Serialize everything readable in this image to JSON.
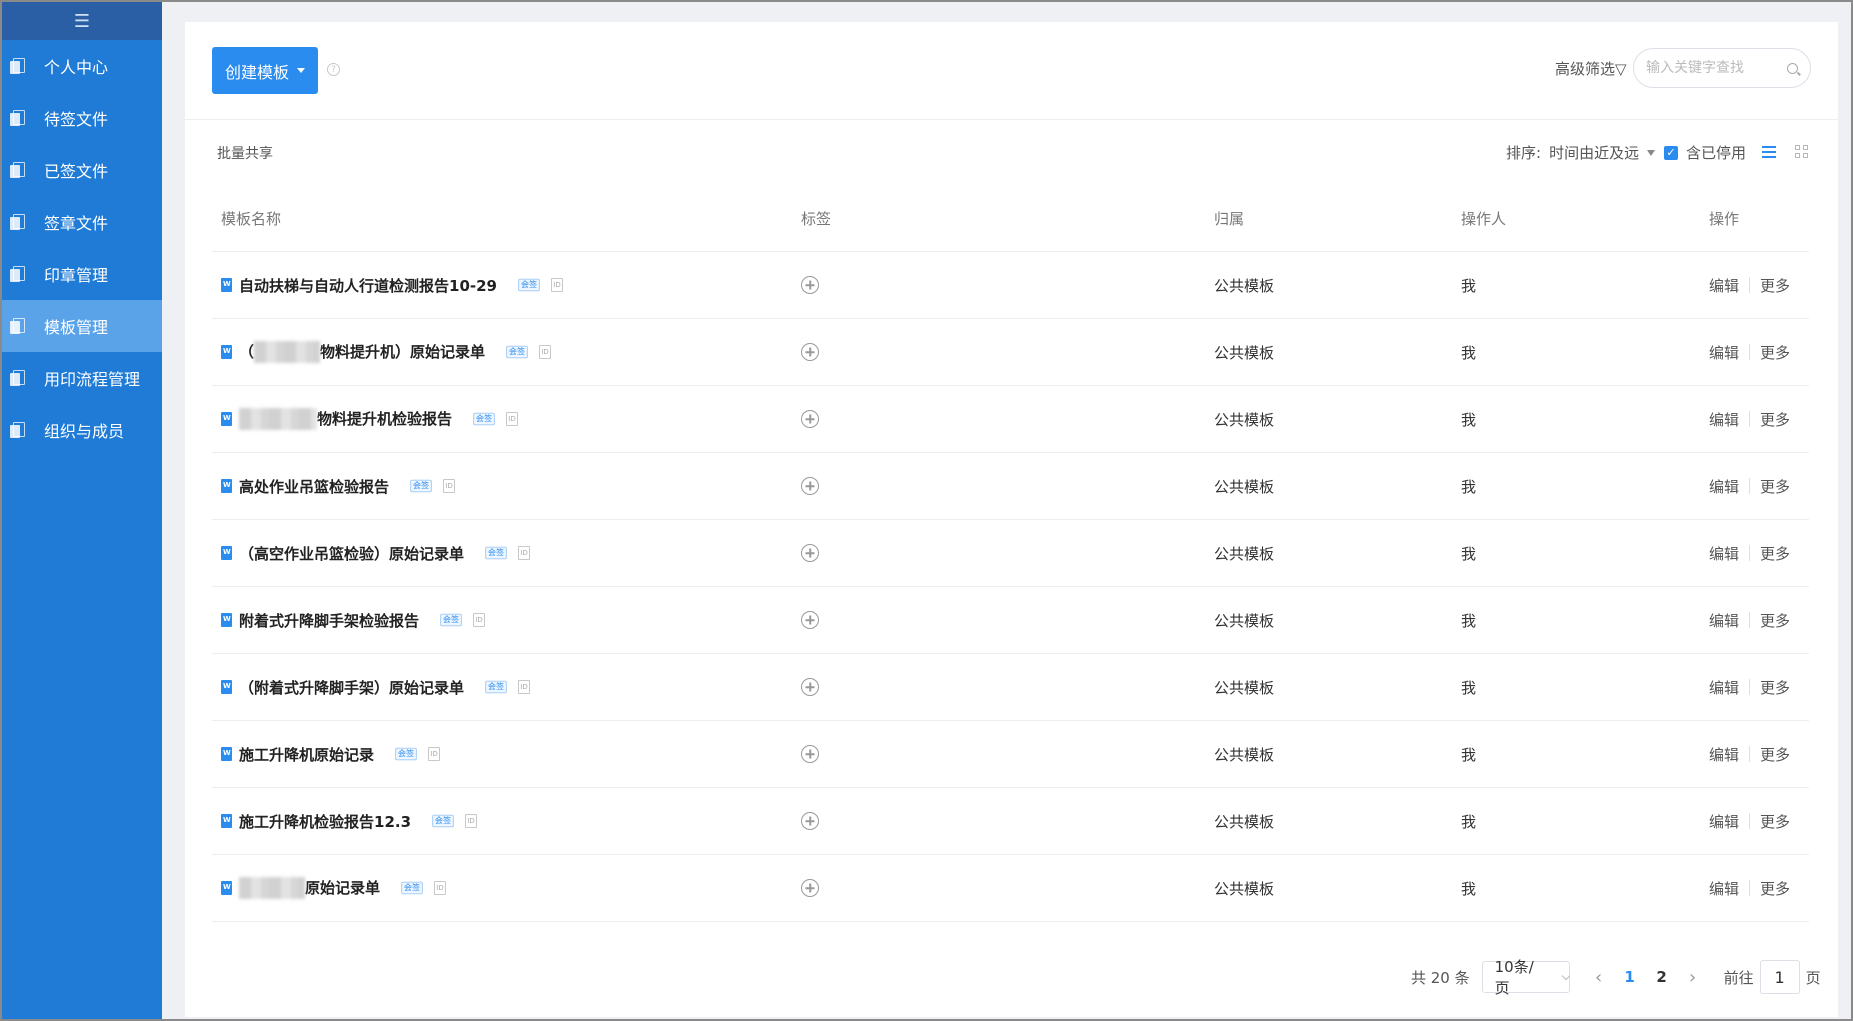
{
  "sidebar": {
    "toggle_icon": "☰",
    "items": [
      {
        "label": "个人中心",
        "active": false
      },
      {
        "label": "待签文件",
        "active": false
      },
      {
        "label": "已签文件",
        "active": false
      },
      {
        "label": "签章文件",
        "active": false
      },
      {
        "label": "印章管理",
        "active": false
      },
      {
        "label": "模板管理",
        "active": true
      },
      {
        "label": "用印流程管理",
        "active": false
      },
      {
        "label": "组织与成员",
        "active": false
      }
    ]
  },
  "toolbar": {
    "create_label": "创建模板",
    "help_icon": "?",
    "advanced_filter": "高级筛选▽",
    "search_placeholder": "输入关键字查找"
  },
  "subbar": {
    "batch_share": "批量共享",
    "sort_label": "排序:",
    "sort_value": "时间由近及远",
    "include_disabled": "含已停用",
    "include_disabled_checked": true,
    "check_mark": "✓"
  },
  "table": {
    "headers": {
      "name": "模板名称",
      "tag": "标签",
      "owner": "归属",
      "operator": "操作人",
      "action": "操作"
    },
    "badge_blue": "会签",
    "badge_gray": "ID",
    "edit_label": "编辑",
    "more_label": "更多",
    "rows": [
      {
        "name": "自动扶梯与自动人行道检测报告10-29",
        "owner": "公共模板",
        "operator": "我"
      },
      {
        "name_prefix": "（",
        "name_suffix": "物料提升机）原始记录单",
        "owner": "公共模板",
        "operator": "我"
      },
      {
        "name_prefix": "",
        "name_suffix": "物料提升机检验报告",
        "owner": "公共模板",
        "operator": "我"
      },
      {
        "name": "高处作业吊篮检验报告",
        "owner": "公共模板",
        "operator": "我"
      },
      {
        "name": "（高空作业吊篮检验）原始记录单",
        "owner": "公共模板",
        "operator": "我"
      },
      {
        "name": "附着式升降脚手架检验报告",
        "owner": "公共模板",
        "operator": "我"
      },
      {
        "name": "（附着式升降脚手架）原始记录单",
        "owner": "公共模板",
        "operator": "我"
      },
      {
        "name": "施工升降机原始记录",
        "owner": "公共模板",
        "operator": "我"
      },
      {
        "name": "施工升降机检验报告12.3",
        "owner": "公共模板",
        "operator": "我"
      },
      {
        "name_prefix": "",
        "name_suffix": "原始记录单",
        "owner": "公共模板",
        "operator": "我"
      }
    ]
  },
  "pagination": {
    "total_text": "共 20 条",
    "page_size": "10条/页",
    "pages": [
      "1",
      "2"
    ],
    "current_page": "1",
    "goto_prefix": "前往",
    "goto_value": "1",
    "goto_suffix": "页",
    "prev_icon": "‹",
    "next_icon": "›"
  },
  "colors": {
    "sidebar_bg": "#1f7bd6",
    "sidebar_active": "#5aa3e8",
    "primary": "#2b8cf0"
  }
}
